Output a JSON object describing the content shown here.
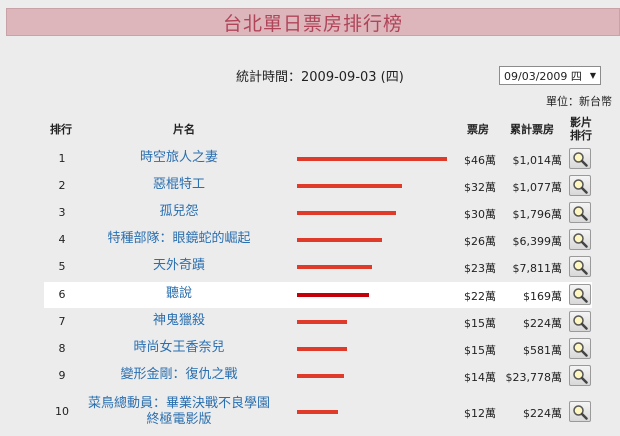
{
  "title": "台北單日票房排行榜",
  "stats_date": "統計時間：2009-09-03 (四)",
  "date_select": "09/03/2009 四",
  "unit": "單位：新台幣",
  "headers": {
    "rank": "排行",
    "name": "片名",
    "gross": "票房",
    "cumulative": "累計票房",
    "film_rank": "影片排行"
  },
  "colors": {
    "bar": "#e03a2a",
    "highlight_bar": "#c4000a",
    "title_bg": "#dcb6bb",
    "title_text": "#b0455a",
    "link": "#2a6fb0"
  },
  "rows": [
    {
      "rank": "1",
      "name": "時空旅人之妻",
      "gross": "$46萬",
      "cumulative": "$1,014萬",
      "bar_fraction": 1.0
    },
    {
      "rank": "2",
      "name": "惡棍特工",
      "gross": "$32萬",
      "cumulative": "$1,077萬",
      "bar_fraction": 0.7
    },
    {
      "rank": "3",
      "name": "孤兒怨",
      "gross": "$30萬",
      "cumulative": "$1,796萬",
      "bar_fraction": 0.66
    },
    {
      "rank": "4",
      "name": "特種部隊：眼鏡蛇的崛起",
      "gross": "$26萬",
      "cumulative": "$6,399萬",
      "bar_fraction": 0.57
    },
    {
      "rank": "5",
      "name": "天外奇蹟",
      "gross": "$23萬",
      "cumulative": "$7,811萬",
      "bar_fraction": 0.5
    },
    {
      "rank": "6",
      "name": "聽說",
      "gross": "$22萬",
      "cumulative": "$169萬",
      "bar_fraction": 0.48,
      "highlight": true
    },
    {
      "rank": "7",
      "name": "神鬼獵殺",
      "gross": "$15萬",
      "cumulative": "$224萬",
      "bar_fraction": 0.33
    },
    {
      "rank": "8",
      "name": "時尚女王香奈兒",
      "gross": "$15萬",
      "cumulative": "$581萬",
      "bar_fraction": 0.33
    },
    {
      "rank": "9",
      "name": "變形金剛：復仇之戰",
      "gross": "$14萬",
      "cumulative": "$23,778萬",
      "bar_fraction": 0.31
    },
    {
      "rank": "10",
      "name_line1": "菜鳥總動員：畢業決戰不良學園",
      "name_line2": "終極電影版",
      "gross": "$12萬",
      "cumulative": "$224萬",
      "bar_fraction": 0.27
    }
  ]
}
